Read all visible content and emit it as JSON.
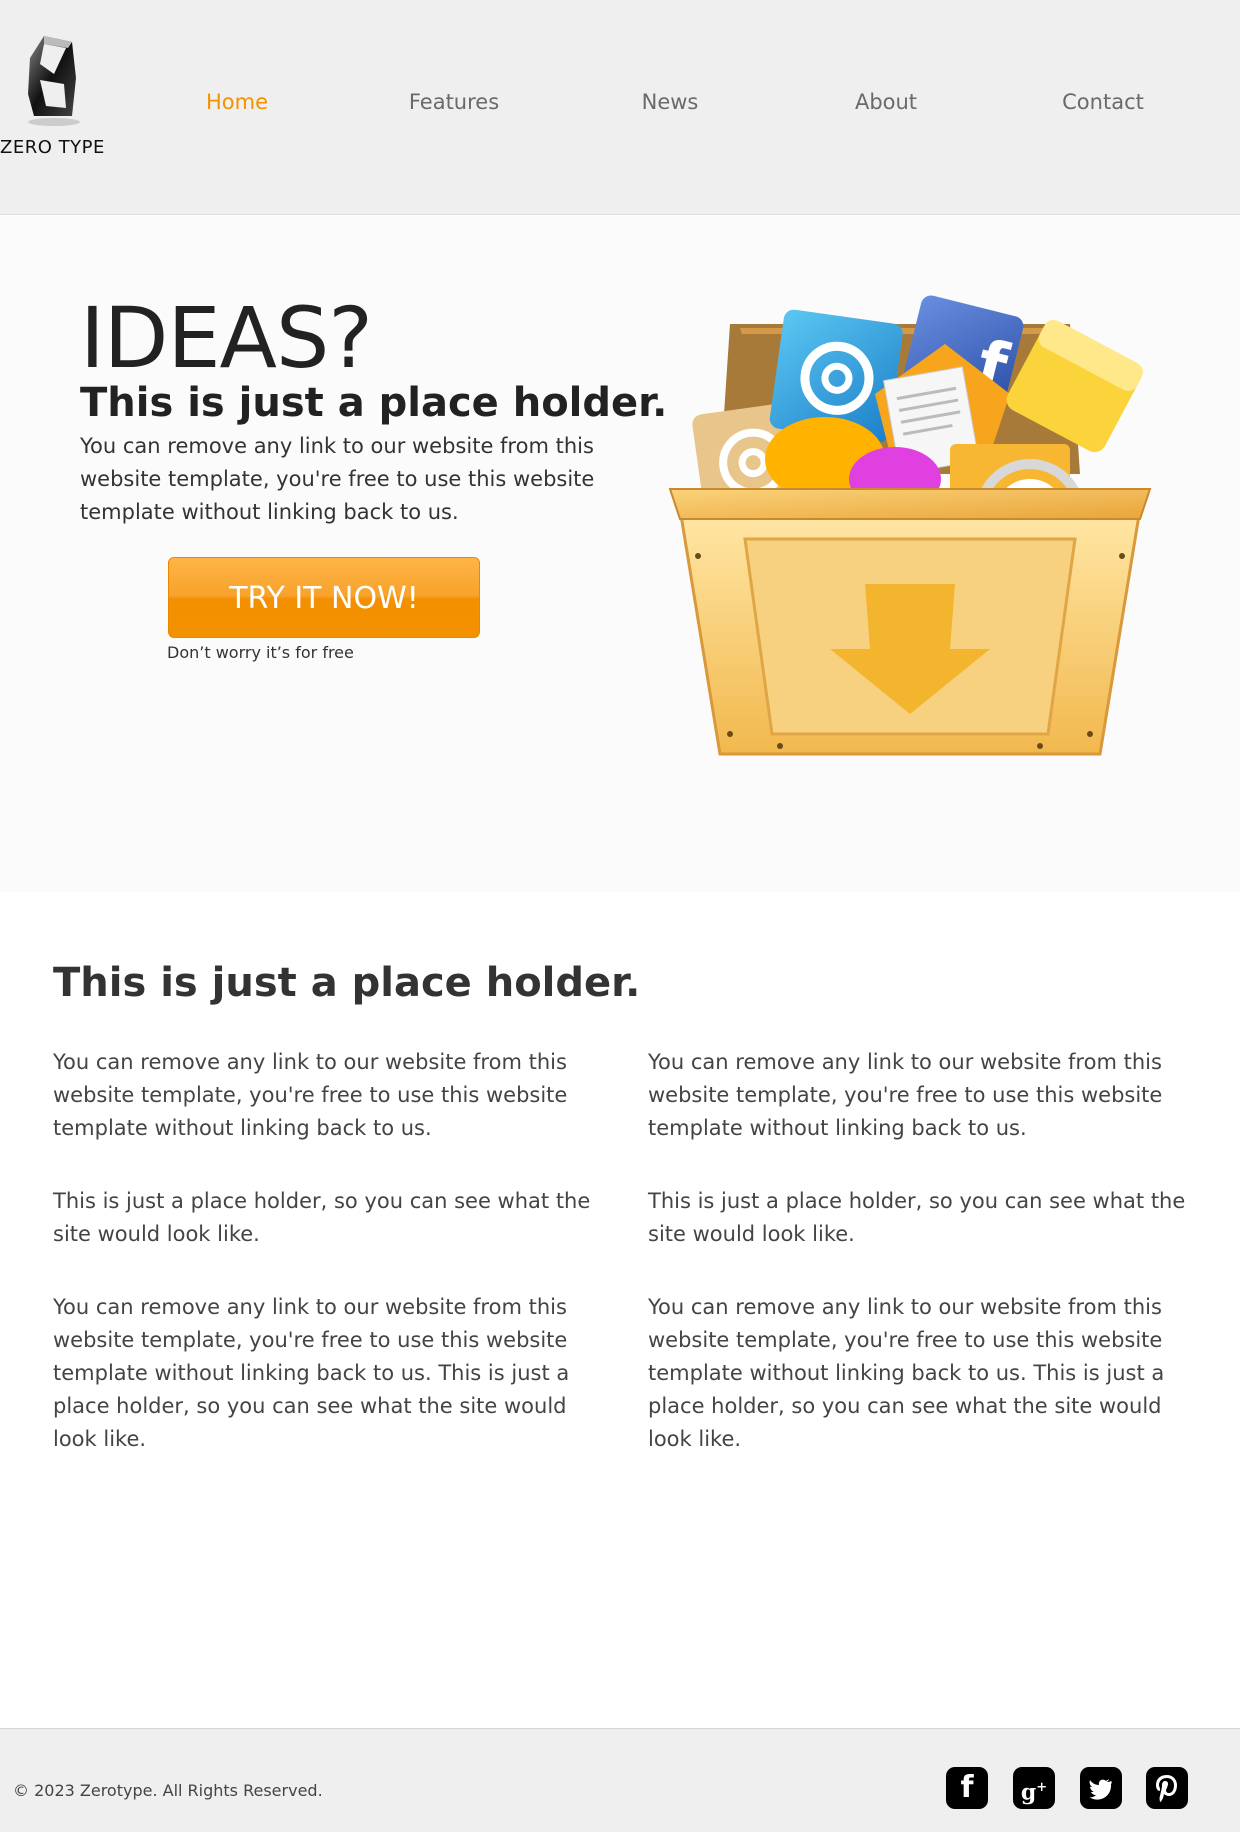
{
  "brand": {
    "name": "ZERO TYPE",
    "logo_icon": "zerotype-logo-icon",
    "accent_color": "#f39200"
  },
  "nav": {
    "items": [
      {
        "label": "Home",
        "active": true
      },
      {
        "label": "Features",
        "active": false
      },
      {
        "label": "News",
        "active": false
      },
      {
        "label": "About",
        "active": false
      },
      {
        "label": "Contact",
        "active": false
      }
    ]
  },
  "hero": {
    "title": "IDEAS?",
    "subtitle": "This is just a place holder.",
    "description": "You can remove any link to our website from this website template, you're free to use this website template without linking back to us.",
    "cta_label": "TRY IT NOW!",
    "cta_note": "Don’t worry it’s for free",
    "illustration_icon": "download-crate-icon"
  },
  "content": {
    "heading": "This is just a place holder.",
    "left_column": [
      "You can remove any link to our website from this website template, you're free to use this website template without linking back to us.",
      "This is just a place holder, so you can see what the site would look like.",
      "You can remove any link to our website from this website template, you're free to use this website template without linking back to us. This is just a place holder, so you can see what the site would look like."
    ],
    "right_column": [
      "You can remove any link to our website from this website template, you're free to use this website template without linking back to us.",
      "This is just a place holder, so you can see what the site would look like.",
      "You can remove any link to our website from this website template, you're free to use this website template without linking back to us. This is just a place holder, so you can see what the site would look like."
    ]
  },
  "footer": {
    "copyright": "© 2023 Zerotype. All Rights Reserved.",
    "social": [
      "facebook-icon",
      "google-plus-icon",
      "twitter-icon",
      "pinterest-icon"
    ]
  }
}
